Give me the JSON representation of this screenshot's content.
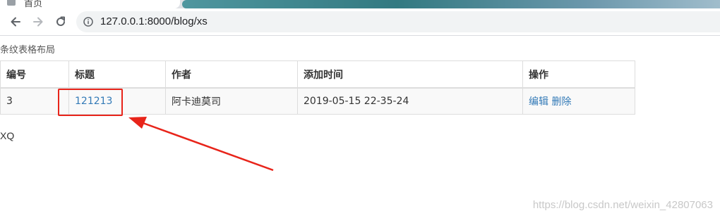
{
  "browser": {
    "tab_title": "首页",
    "url": "127.0.0.1:8000/blog/xs"
  },
  "page": {
    "heading": "条纹表格布局",
    "table": {
      "headers": [
        "编号",
        "标题",
        "作者",
        "添加时间",
        "操作"
      ],
      "rows": [
        {
          "id": "3",
          "title": "121213",
          "author": "阿卡迪莫司",
          "added_time": "2019-05-15 22-35-24",
          "action_edit": "编辑",
          "action_delete": "删除"
        }
      ]
    },
    "footer_text": "XQ"
  },
  "watermark": "https://blog.csdn.net/weixin_42807063",
  "colors": {
    "link": "#337ab7",
    "annotation": "#e8241a"
  }
}
